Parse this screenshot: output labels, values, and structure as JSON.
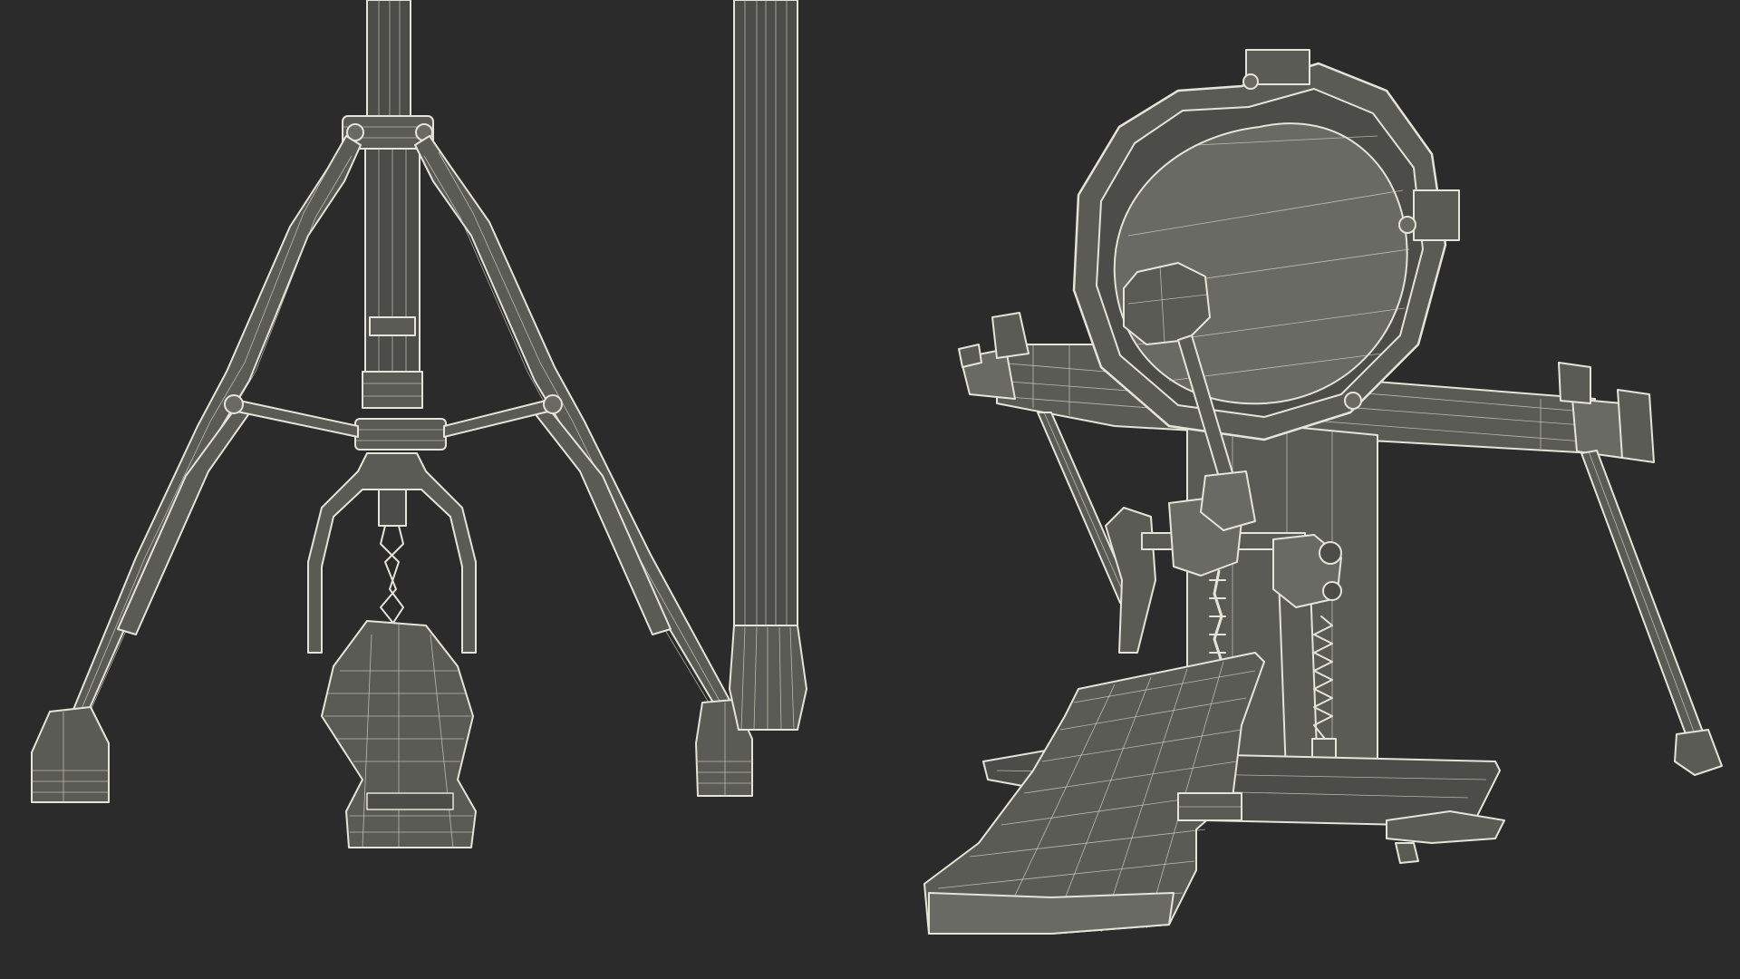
{
  "scene": {
    "background": "#2b2b2b",
    "wire_color": "#e4e4d8",
    "surface_color": "#5b5b56",
    "objects": [
      {
        "name": "hi-hat-stand"
      },
      {
        "name": "stand-tube"
      },
      {
        "name": "kick-drum-trigger-pad"
      }
    ]
  }
}
